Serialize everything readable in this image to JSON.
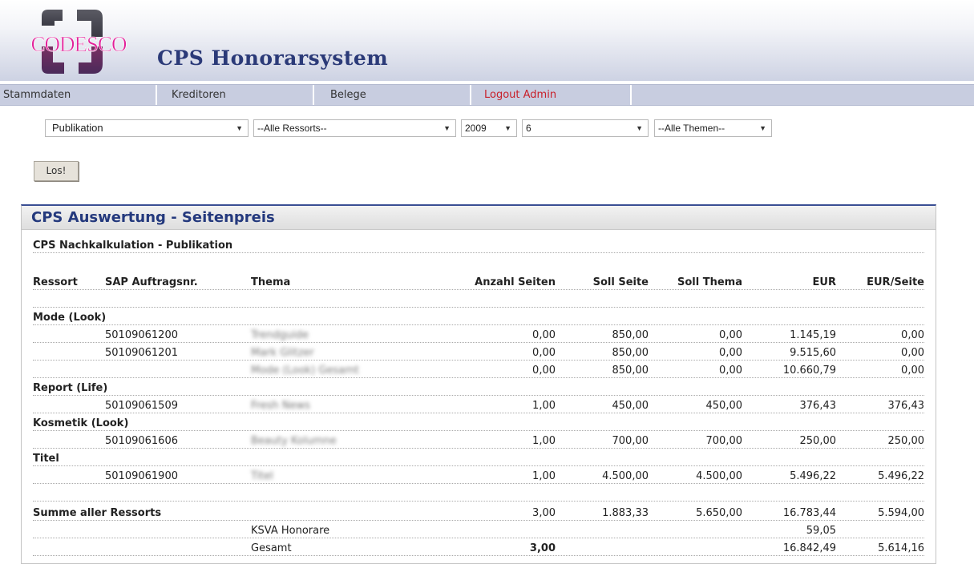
{
  "app": {
    "logo_text": "CODESCO",
    "title": "CPS Honorarsystem"
  },
  "menu": [
    {
      "label": "Stammdaten"
    },
    {
      "label": "Kreditoren"
    },
    {
      "label": "Belege"
    },
    {
      "label": "Logout Admin"
    },
    {
      "label": ""
    }
  ],
  "filters": {
    "type": "Publikation",
    "ressort": "--Alle Ressorts--",
    "year": "2009",
    "month": "6",
    "thema": "--Alle Themen--",
    "submit_label": "Los!"
  },
  "report": {
    "panel_title": "CPS Auswertung - Seitenpreis",
    "subtitle": "CPS Nachkalkulation - Publikation",
    "columns": [
      "Ressort",
      "SAP Auftragsnr.",
      "Thema",
      "Anzahl Seiten",
      "Soll Seite",
      "Soll Thema",
      "EUR",
      "EUR/Seite"
    ],
    "rows": [
      {
        "ressort": "Mode (Look)"
      },
      {
        "sap": "50109061200",
        "thema": "Trendguide",
        "seiten": "0,00",
        "soll_seite": "850,00",
        "soll_thema": "0,00",
        "eur": "1.145,19",
        "eur_seite": "0,00"
      },
      {
        "sap": "50109061201",
        "thema": "Mark Glitzer",
        "seiten": "0,00",
        "soll_seite": "850,00",
        "soll_thema": "0,00",
        "eur": "9.515,60",
        "eur_seite": "0,00"
      },
      {
        "thema": "Mode (Look) Gesamt",
        "seiten": "0,00",
        "soll_seite": "850,00",
        "soll_thema": "0,00",
        "eur": "10.660,79",
        "eur_seite": "0,00"
      },
      {
        "ressort": "Report (Life)"
      },
      {
        "sap": "50109061509",
        "thema": "Fresh News",
        "seiten": "1,00",
        "soll_seite": "450,00",
        "soll_thema": "450,00",
        "eur": "376,43",
        "eur_seite": "376,43"
      },
      {
        "ressort": "Kosmetik (Look)"
      },
      {
        "sap": "50109061606",
        "thema": "Beauty Kolumne",
        "seiten": "1,00",
        "soll_seite": "700,00",
        "soll_thema": "700,00",
        "eur": "250,00",
        "eur_seite": "250,00"
      },
      {
        "ressort": "Titel"
      },
      {
        "sap": "50109061900",
        "thema": "Titel",
        "seiten": "1,00",
        "soll_seite": "4.500,00",
        "soll_thema": "4.500,00",
        "eur": "5.496,22",
        "eur_seite": "5.496,22"
      }
    ],
    "summary": {
      "label": "Summe aller Ressorts",
      "seiten": "3,00",
      "soll_seite": "1.883,33",
      "soll_thema": "5.650,00",
      "eur": "16.783,44",
      "eur_seite": "5.594,00"
    },
    "ksva": {
      "label": "KSVA Honorare",
      "eur": "59,05"
    },
    "gesamt": {
      "label": "Gesamt",
      "seiten": "3,00",
      "eur": "16.842,49",
      "eur_seite": "5.614,16"
    }
  }
}
